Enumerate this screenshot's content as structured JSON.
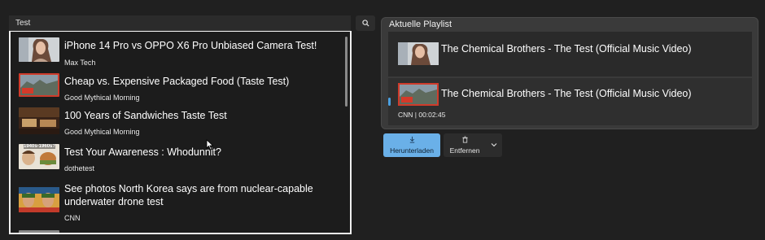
{
  "search": {
    "query": "Test",
    "button_icon": "search-icon"
  },
  "results": [
    {
      "title": "iPhone 14 Pro vs OPPO X6 Pro Unbiased Camera Test!",
      "channel": "Max Tech",
      "thumb": "portrait"
    },
    {
      "title": "Cheap vs. Expensive Packaged Food (Taste Test)",
      "channel": "Good Mythical Morning",
      "thumb": "landscape-red"
    },
    {
      "title": "100 Years of Sandwiches Taste Test",
      "channel": "Good Mythical Morning",
      "thumb": "sandwich"
    },
    {
      "title": "Test Your Awareness : Whodunnit?",
      "channel": "dothetest",
      "thumb": "people",
      "thumb_text": "1940s-1960s?"
    },
    {
      "title": "See photos North Korea says are from nuclear-capable underwater drone test",
      "channel": "CNN",
      "thumb": "group"
    }
  ],
  "playlist": {
    "header": "Aktuelle Playlist",
    "items": [
      {
        "title": "The Chemical Brothers - The Test (Official Music Video)",
        "thumb": "portrait"
      },
      {
        "title": "The Chemical Brothers - The Test (Official Music Video)",
        "thumb": "landscape-red",
        "meta": "CNN | 00:02:45"
      }
    ]
  },
  "actions": {
    "download_label": "Herunterladen",
    "remove_label": "Entfernen"
  },
  "colors": {
    "accent": "#6ab0e8",
    "background": "#202020",
    "panel": "#3a3a3a"
  }
}
